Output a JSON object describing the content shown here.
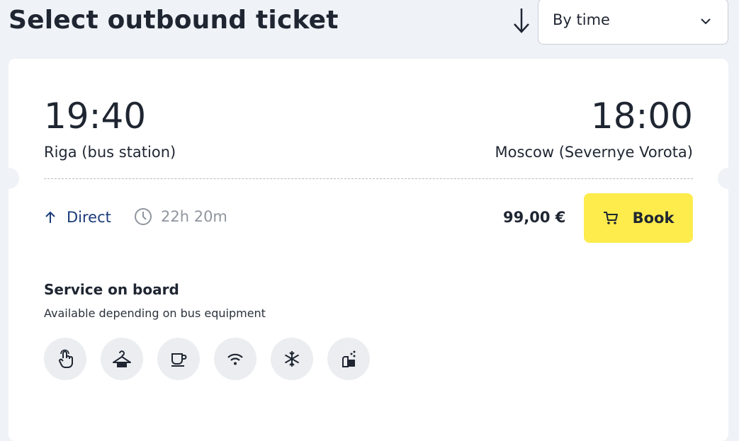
{
  "header": {
    "title": "Select outbound ticket",
    "sort_label": "By time"
  },
  "trip": {
    "departure_time": "19:40",
    "arrival_time": "18:00",
    "departure_station": "Riga (bus station)",
    "arrival_station": "Moscow (Severnye Vorota)",
    "route_type": "Direct",
    "duration": "22h 20m",
    "price": "99,00 €",
    "book_label": "Book"
  },
  "services": {
    "title": "Service on board",
    "subtitle": "Available depending on bus equipment",
    "icons": [
      "touch-screen-icon",
      "wardrobe-hanger-icon",
      "coffee-icon",
      "wifi-icon",
      "air-conditioning-icon",
      "washroom-icon"
    ]
  },
  "colors": {
    "page_bg": "#eff2f7",
    "accent_yellow": "#fdec4c",
    "link_blue": "#1b3b78"
  }
}
